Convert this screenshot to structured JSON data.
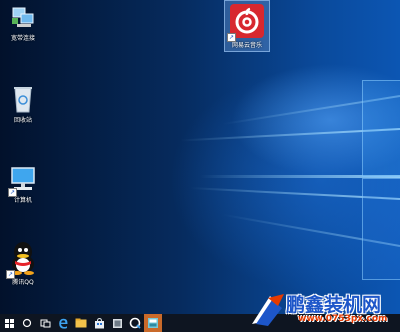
{
  "desktop": {
    "icons": [
      {
        "name": "network-icon",
        "label": "宽带连接"
      },
      {
        "name": "recycle-bin-icon",
        "label": "回收站"
      },
      {
        "name": "computer-icon",
        "label": "计算机"
      },
      {
        "name": "qq-icon",
        "label": "腾讯QQ"
      },
      {
        "name": "netease-music-icon",
        "label": "网易云音乐"
      }
    ]
  },
  "taskbar": {
    "items": [
      "start",
      "search",
      "task-view",
      "edge",
      "file-explorer",
      "store",
      "app-1",
      "qq-browser",
      "active-app"
    ]
  },
  "watermark": {
    "title": "鹏鑫装机网",
    "url": "www.0753px.com"
  },
  "colors": {
    "desktop_dark": "#02112b",
    "desktop_light": "#0c56b3",
    "taskbar": "#0e1521",
    "netease_red": "#d7282f",
    "watermark_blue": "#1d56c9",
    "watermark_orange": "#e63a00"
  }
}
